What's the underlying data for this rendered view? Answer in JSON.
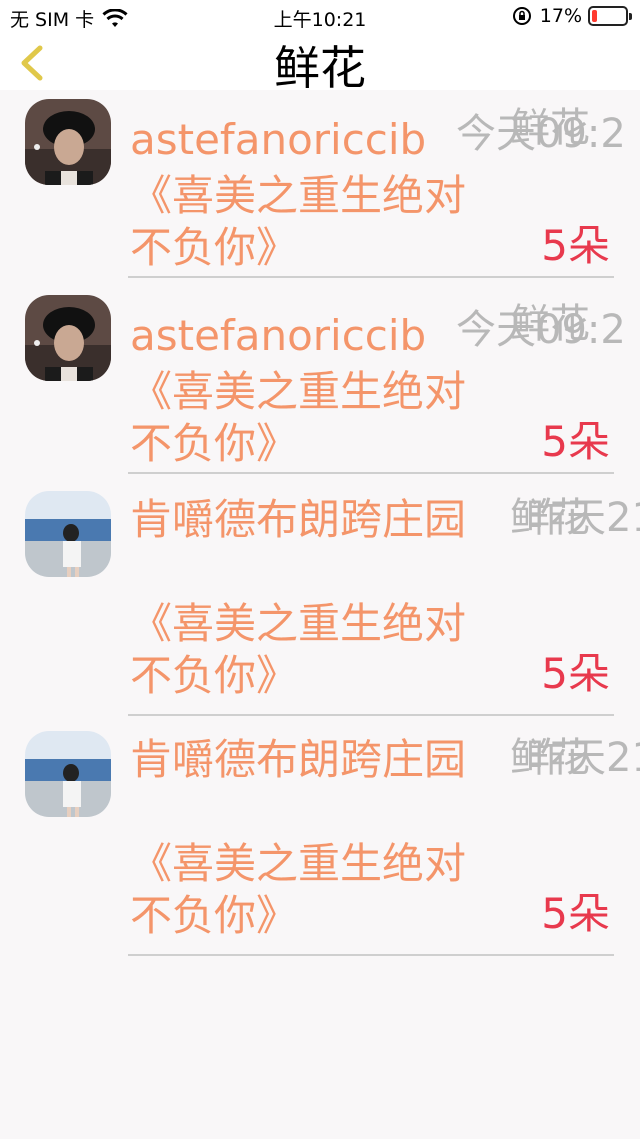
{
  "status_bar": {
    "carrier": "无 SIM 卡",
    "time": "上午10:21",
    "battery_text": "17%",
    "battery_level": 0.17,
    "battery_color": "#ff3b30"
  },
  "nav": {
    "title": "鲜花",
    "back_icon": "chevron-left-icon",
    "back_color": "#e0c84a"
  },
  "colors": {
    "name": "#f4956a",
    "gift": "#e8394d",
    "meta": "#b8b8b8"
  },
  "items": [
    {
      "name": "astefanoriccib",
      "book": "《喜美之重生绝对不负你》",
      "gift_count": "5朵",
      "meta_a": "今天09:2",
      "meta_b": "鲜花",
      "avatar": "avatar-man-hat"
    },
    {
      "name": "astefanoriccib",
      "book": "《喜美之重生绝对不负你》",
      "gift_count": "5朵",
      "meta_a": "今天09:2",
      "meta_b": "鲜花",
      "avatar": "avatar-man-hat"
    },
    {
      "name": "肯嚼德布朗跨庄园",
      "book": "《喜美之重生绝对不负你》",
      "gift_count": "5朵",
      "meta_a": "鲜花",
      "meta_b": "昨天21",
      "avatar": "avatar-girl-beach"
    },
    {
      "name": "肯嚼德布朗跨庄园",
      "book": "《喜美之重生绝对不负你》",
      "gift_count": "5朵",
      "meta_a": "鲜花",
      "meta_b": "昨天21",
      "avatar": "avatar-girl-beach"
    }
  ]
}
